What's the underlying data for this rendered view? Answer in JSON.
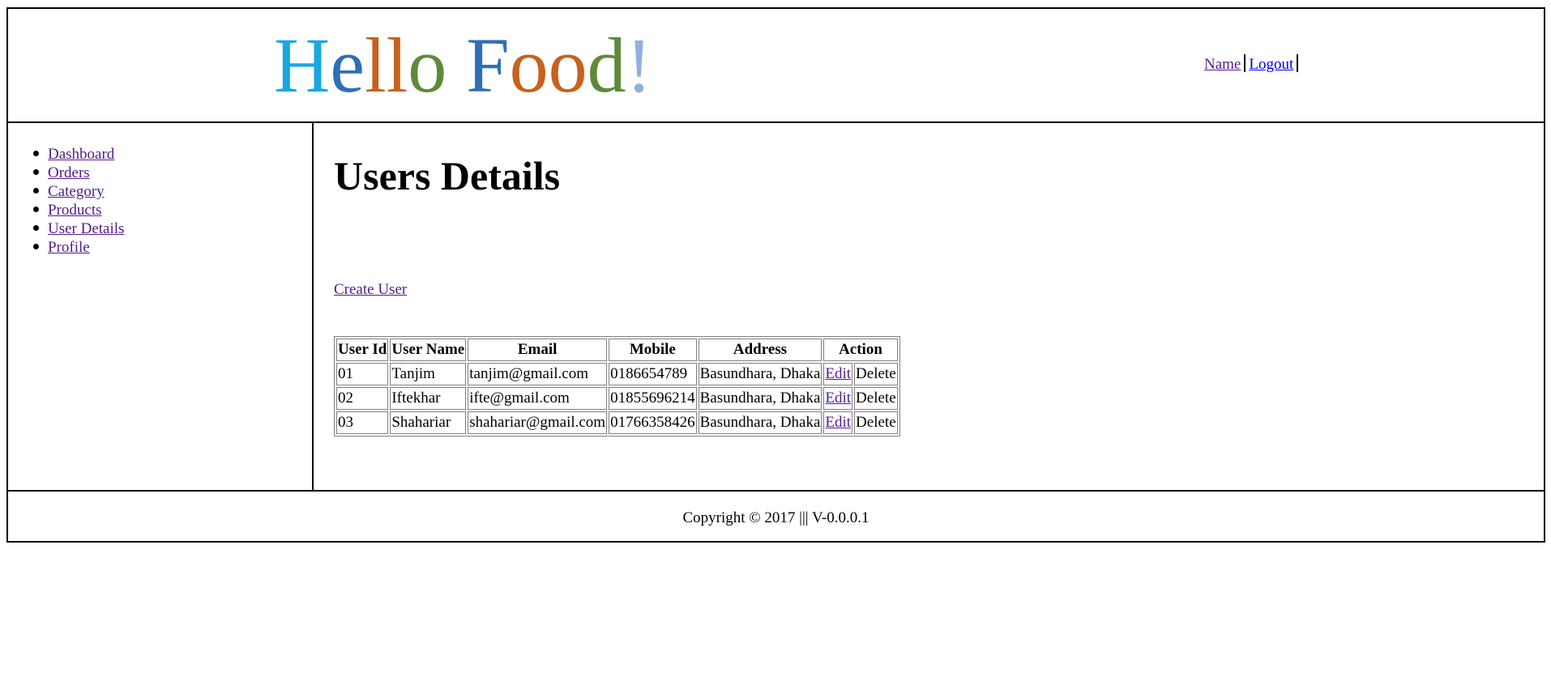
{
  "header": {
    "logo": {
      "letters": [
        {
          "ch": "H",
          "color": "#18a8e0"
        },
        {
          "ch": "e",
          "color": "#2f6fb4"
        },
        {
          "ch": "l",
          "color": "#c6621d"
        },
        {
          "ch": "l",
          "color": "#c6621d"
        },
        {
          "ch": "o",
          "color": "#5e8a3a"
        },
        {
          "ch": " ",
          "color": "#000000"
        },
        {
          "ch": "F",
          "color": "#2f6fb4"
        },
        {
          "ch": "o",
          "color": "#c6621d"
        },
        {
          "ch": "o",
          "color": "#c6621d"
        },
        {
          "ch": "d",
          "color": "#5e8a3a"
        },
        {
          "ch": "!",
          "color": "#8fb0e0"
        }
      ]
    },
    "links": {
      "name": "Name",
      "logout": "Logout"
    }
  },
  "sidebar": {
    "items": [
      {
        "label": "Dashboard"
      },
      {
        "label": "Orders"
      },
      {
        "label": "Category"
      },
      {
        "label": "Products"
      },
      {
        "label": "User Details"
      },
      {
        "label": "Profile"
      }
    ]
  },
  "main": {
    "title": "Users Details",
    "create_link": "Create User",
    "table": {
      "columns": [
        "User Id",
        "User Name",
        "Email",
        "Mobile",
        "Address",
        "Action"
      ],
      "rows": [
        {
          "id": "01",
          "name": "Tanjim",
          "email": "tanjim@gmail.com",
          "mobile": "0186654789",
          "address": "Basundhara, Dhaka",
          "edit": "Edit",
          "delete": "Delete"
        },
        {
          "id": "02",
          "name": "Iftekhar",
          "email": "ifte@gmail.com",
          "mobile": "01855696214",
          "address": "Basundhara, Dhaka",
          "edit": "Edit",
          "delete": "Delete"
        },
        {
          "id": "03",
          "name": "Shahariar",
          "email": "shahariar@gmail.com",
          "mobile": "01766358426",
          "address": "Basundhara, Dhaka",
          "edit": "Edit",
          "delete": "Delete"
        }
      ]
    }
  },
  "footer": {
    "text": "Copyright © 2017 ||| V-0.0.0.1"
  }
}
